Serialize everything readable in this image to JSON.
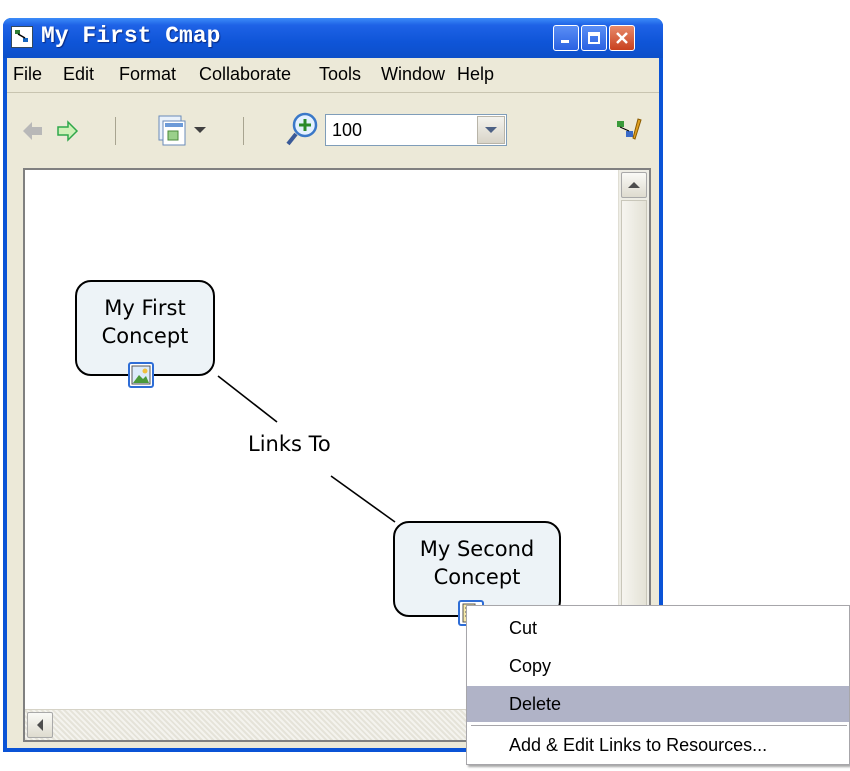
{
  "window": {
    "title": "My First Cmap"
  },
  "menubar": {
    "items": [
      "File",
      "Edit",
      "Format",
      "Collaborate",
      "Tools",
      "Window",
      "Help"
    ]
  },
  "toolbar": {
    "zoom_value": "100"
  },
  "map": {
    "concepts": [
      {
        "label_line1": "My First",
        "label_line2": "Concept"
      },
      {
        "label_line1": "My Second",
        "label_line2": "Concept"
      }
    ],
    "link_label": "Links To"
  },
  "context_menu": {
    "items": [
      "Cut",
      "Copy",
      "Delete",
      "Add & Edit Links to Resources..."
    ],
    "selected": "Delete"
  },
  "colors": {
    "titlebar": "#0A53D6",
    "concept_fill": "#EDF3F7",
    "menu_highlight": "#B0B3C7"
  }
}
